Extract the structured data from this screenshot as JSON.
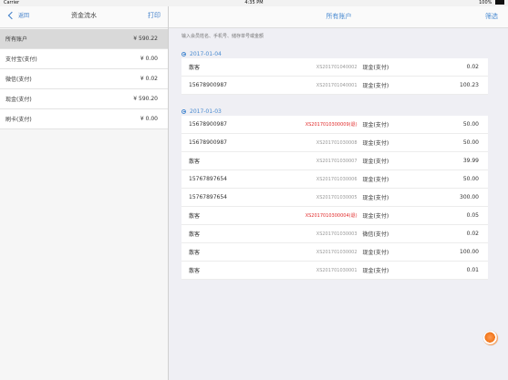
{
  "status_bar": {
    "carrier": "Carrier",
    "time": "4:35 PM",
    "battery": "100%"
  },
  "left_nav": {
    "back_label": "返回",
    "title": "资金流水",
    "print_label": "打印"
  },
  "accounts": [
    {
      "name": "所有账户",
      "value": "¥ 590.22",
      "active": true
    },
    {
      "name": "支付宝(支付)",
      "value": "¥ 0.00",
      "active": false
    },
    {
      "name": "微信(支付)",
      "value": "¥ 0.02",
      "active": false
    },
    {
      "name": "现金(支付)",
      "value": "¥ 590.20",
      "active": false
    },
    {
      "name": "刷卡(支付)",
      "value": "¥ 0.00",
      "active": false
    }
  ],
  "right_nav": {
    "title": "所有账户",
    "filter_label": "筛选"
  },
  "search": {
    "placeholder": "输入会员姓名、手机号、储存单号或金额"
  },
  "sections": [
    {
      "date": "2017-01-04",
      "rows": [
        {
          "name": "散客",
          "id": "XS201701040002",
          "method": "现金(支付)",
          "amount": "0.02",
          "refund": false
        },
        {
          "name": "15678900987",
          "id": "XS201701040001",
          "method": "现金(支付)",
          "amount": "100.23",
          "refund": false
        }
      ]
    },
    {
      "date": "2017-01-03",
      "rows": [
        {
          "name": "15678900987",
          "id": "XS2017010300009(退)",
          "method": "现金(支付)",
          "amount": "50.00",
          "refund": true
        },
        {
          "name": "15678900987",
          "id": "XS201701030008",
          "method": "现金(支付)",
          "amount": "50.00",
          "refund": false
        },
        {
          "name": "散客",
          "id": "XS201701030007",
          "method": "现金(支付)",
          "amount": "39.99",
          "refund": false
        },
        {
          "name": "15767897654",
          "id": "XS201701030006",
          "method": "现金(支付)",
          "amount": "50.00",
          "refund": false
        },
        {
          "name": "15767897654",
          "id": "XS201701030005",
          "method": "现金(支付)",
          "amount": "300.00",
          "refund": false
        },
        {
          "name": "散客",
          "id": "XS2017010300004(退)",
          "method": "现金(支付)",
          "amount": "0.05",
          "refund": true
        },
        {
          "name": "散客",
          "id": "XS201701030003",
          "method": "微信(支付)",
          "amount": "0.02",
          "refund": false
        },
        {
          "name": "散客",
          "id": "XS201701030002",
          "method": "现金(支付)",
          "amount": "100.00",
          "refund": false
        },
        {
          "name": "散客",
          "id": "XS201701030001",
          "method": "现金(支付)",
          "amount": "0.01",
          "refund": false
        }
      ]
    }
  ],
  "colors": {
    "accent": "#4a8bd1",
    "refund": "#e12b2b",
    "selected_row": "#d9d9d9",
    "panel": "#efeff4"
  }
}
